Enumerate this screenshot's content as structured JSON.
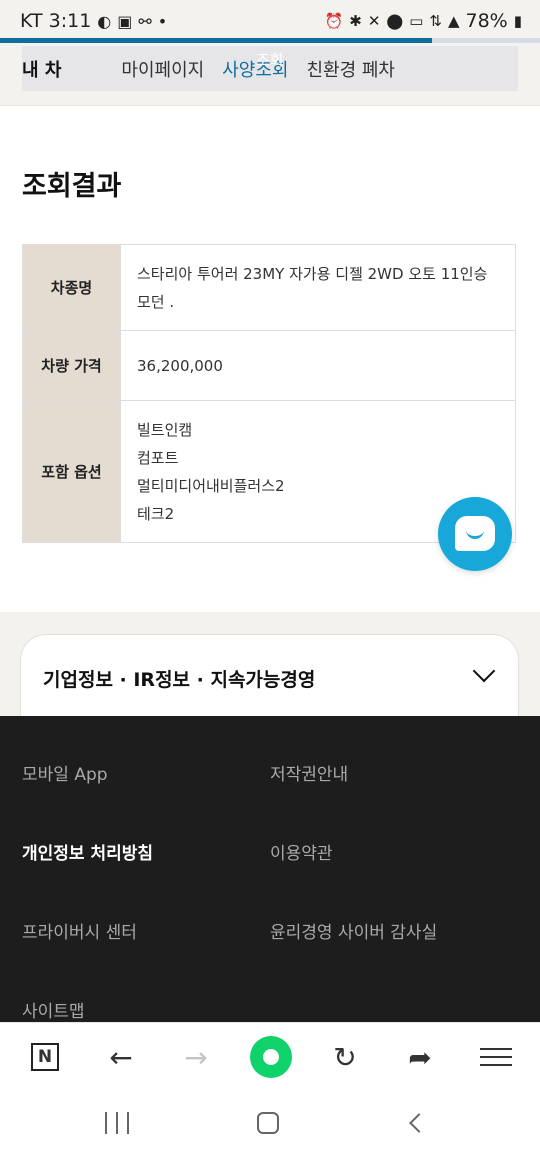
{
  "status_bar": {
    "carrier_time": "KT 3:11",
    "battery": "78%",
    "left_icons": [
      "moon-icon",
      "image-icon",
      "link-icon",
      "dot-icon"
    ],
    "right_icons": [
      "alarm-icon",
      "bluetooth-icon",
      "mute-icon",
      "location-icon",
      "hd-icon",
      "5g-icon",
      "signal-icon",
      "battery-icon"
    ]
  },
  "page_progress": 0.8,
  "nav": {
    "tabs": [
      "내 차",
      "마이페이지",
      "사양조회",
      "친환경 폐차"
    ],
    "active_tab": "사양조회",
    "overlay_label": "조회"
  },
  "page_title": "조회결과",
  "result_table": {
    "rows": [
      {
        "label": "차종명",
        "value": [
          "스타리아 투어러 23MY 자가용 디젤 2WD 오토 11인승",
          "모던 ."
        ]
      },
      {
        "label": "차량 가격",
        "value": [
          "36,200,000"
        ]
      },
      {
        "label": "포함 옵션",
        "value": [
          "빌트인캠",
          "컴포트",
          "멀티미디어내비플러스2",
          "테크2"
        ]
      }
    ]
  },
  "chat_button": {
    "icon": "chat-icon",
    "color": "#17a7d8"
  },
  "accordion": {
    "title": "기업정보 · IR정보 · 지속가능경영",
    "icon": "chevron-down-icon"
  },
  "footer": {
    "links": [
      {
        "label": "모바일 App",
        "bold": false
      },
      {
        "label": "저작권안내",
        "bold": false
      },
      {
        "label": "개인정보 처리방침",
        "bold": true
      },
      {
        "label": "이용약관",
        "bold": false
      },
      {
        "label": "프라이버시 센터",
        "bold": false
      },
      {
        "label": "윤리경영 사이버 감사실",
        "bold": false
      },
      {
        "label": "사이트맵",
        "bold": false
      }
    ]
  },
  "browser_toolbar": {
    "n_label": "N",
    "buttons": [
      "naver-icon",
      "back-arrow-icon",
      "forward-arrow-icon",
      "home-icon",
      "refresh-icon",
      "share-icon",
      "menu-icon"
    ]
  },
  "colors": {
    "accent": "#0e6ea0",
    "table_header_bg": "#e4dcd1",
    "footer_bg": "#1d1d1d",
    "home_green": "#0fd26b"
  }
}
